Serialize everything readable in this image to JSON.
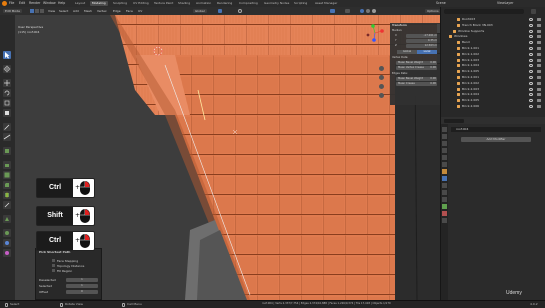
{
  "menu": {
    "items": [
      "File",
      "Edit",
      "Render",
      "Window",
      "Help"
    ],
    "workspace_tabs": [
      "Layout",
      "Modeling",
      "Sculpting",
      "UV Editing",
      "Texture Paint",
      "Shading",
      "Animation",
      "Rendering",
      "Compositing",
      "Geometry Nodes",
      "Scripting",
      "Asset Manager"
    ],
    "active_tab": "Modeling",
    "scene_label": "Scene",
    "view_layer_label": "ViewLayer"
  },
  "header": {
    "mode": "Edit Mode",
    "orientation_label": "Orientation:",
    "orientation_value": "Default",
    "drag_label": "Drag:",
    "drag_value": "Select Box",
    "view_menus": [
      "View",
      "Select",
      "Add",
      "Mesh",
      "Vertex",
      "Edge",
      "Face",
      "UV"
    ],
    "transform_label": "Global",
    "options_label": "Options"
  },
  "viewport": {
    "perspective_label": "User Perspective",
    "object_label": "(115) roof.004",
    "accent": "#e07b4f"
  },
  "npanel": {
    "title": "Transform",
    "median_label": "Median:",
    "x_label": "X",
    "x_value": "-17.261 m",
    "y_label": "Y",
    "y_value": "0.35 m",
    "z_label": "Z",
    "z_value": "12.563 m",
    "global_label": "Global",
    "local_label": "Local",
    "vertex_data_title": "Vertex Data:",
    "mean_bevel_weight_label": "Mean Bevel Weight",
    "mean_bevel_weight_value": "0.00",
    "mean_vertex_crease_label": "Mean Vertex Crease",
    "mean_vertex_crease_value": "0.00",
    "edges_data_title": "Edges Data:",
    "edge_bevel_weight_label": "Mean Bevel Weight",
    "edge_bevel_weight_value": "0.00",
    "edge_crease_label": "Mean Crease",
    "edge_crease_value": "0.00",
    "tabs": [
      "Item",
      "Tool",
      "View",
      "Edit"
    ]
  },
  "outliner": {
    "search_placeholder": "",
    "items": [
      {
        "label": "Roof.003",
        "indent": 3
      },
      {
        "label": "Trench Block 3N.003",
        "indent": 3
      },
      {
        "label": "Window Supports",
        "indent": 2
      },
      {
        "label": "Windows",
        "indent": 1
      },
      {
        "label": "Bend",
        "indent": 3
      },
      {
        "label": "Brick.1.001",
        "indent": 3
      },
      {
        "label": "Brick.1.002",
        "indent": 3
      },
      {
        "label": "Brick.1.003",
        "indent": 3
      },
      {
        "label": "Brick.1.004",
        "indent": 3
      },
      {
        "label": "Brick.1.005",
        "indent": 3
      },
      {
        "label": "Brick.2.001",
        "indent": 3
      },
      {
        "label": "Brick.2.002",
        "indent": 3
      },
      {
        "label": "Brick.2.003",
        "indent": 3
      },
      {
        "label": "Brick.2.004",
        "indent": 3
      },
      {
        "label": "Brick.2.005",
        "indent": 3
      },
      {
        "label": "Brick.2.006",
        "indent": 3
      }
    ]
  },
  "properties": {
    "object_name": "roof.004",
    "add_modifier_label": "Add Modifier"
  },
  "lastop": {
    "title": "Pick Shortest Path",
    "face_stepping": "Face Stepping",
    "topology_distance": "Topology Distance",
    "fill_region": "Fill Region",
    "deselected_label": "Deselected",
    "deselected_value": "1",
    "selected_label": "Selected",
    "selected_value": "1",
    "offset_label": "Offset",
    "offset_value": "0"
  },
  "keys": {
    "key1": "Ctrl",
    "key2": "Shift",
    "key3": "Ctrl"
  },
  "status": {
    "select": "Select",
    "rotate": "Rotate View",
    "call_menu": "Call Menu",
    "stats": "roof.004 | Verts 2,337/7,754 | Edges 2,374/10,888 | Faces 1,226/9,374 | Tris 17,418 | Objects 1/170",
    "version": "4.0.2"
  },
  "watermark": "Udemy"
}
